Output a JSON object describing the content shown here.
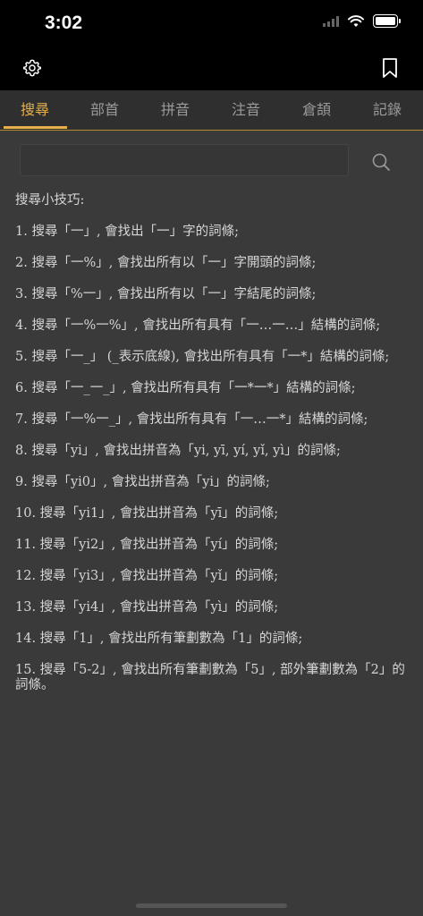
{
  "status_bar": {
    "time": "3:02"
  },
  "tabs": [
    "搜尋",
    "部首",
    "拼音",
    "注音",
    "倉頡",
    "記錄"
  ],
  "active_tab": 0,
  "search": {
    "value": "",
    "placeholder": ""
  },
  "tips": {
    "title": "搜尋小技巧:",
    "items": [
      "1. 搜尋「一」, 會找出「一」字的詞條;",
      "2. 搜尋「一%」, 會找出所有以「一」字開頭的詞條;",
      "3. 搜尋「%一」, 會找出所有以「一」字結尾的詞條;",
      "4. 搜尋「一%一%」, 會找出所有具有「一…一…」結構的詞條;",
      "5. 搜尋「一_」 (_表示底線), 會找出所有具有「一*」結構的詞條;",
      "6. 搜尋「一_一_」, 會找出所有具有「一*一*」結構的詞條;",
      "7. 搜尋「一%一_」, 會找出所有具有「一…一*」結構的詞條;",
      "8. 搜尋「yi」, 會找出拼音為「yi, yī, yí, yǐ, yì」的詞條;",
      "9. 搜尋「yi0」, 會找出拼音為「yi」的詞條;",
      "10. 搜尋「yi1」, 會找出拼音為「yī」的詞條;",
      "11. 搜尋「yi2」, 會找出拼音為「yí」的詞條;",
      "12. 搜尋「yi3」, 會找出拼音為「yǐ」的詞條;",
      "13. 搜尋「yi4」, 會找出拼音為「yì」的詞條;",
      "14. 搜尋「1」, 會找出所有筆劃數為「1」的詞條;",
      "15. 搜尋「5-2」, 會找出所有筆劃數為「5」, 部外筆劃數為「2」的詞條。"
    ]
  },
  "colors": {
    "accent": "#e6b04a",
    "background": "#3a3a3a",
    "bar": "#000000"
  },
  "icons": {
    "settings": "gear-icon",
    "bookmark": "bookmark-icon",
    "search": "search-icon"
  }
}
